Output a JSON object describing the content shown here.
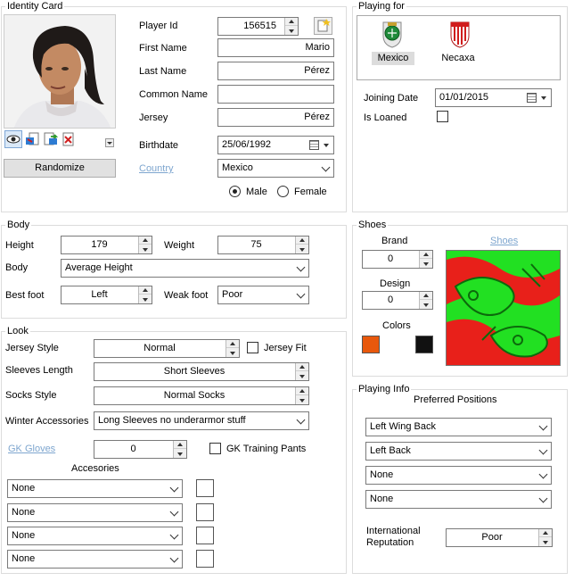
{
  "identity": {
    "title": "Identity Card",
    "player_id_label": "Player Id",
    "player_id": "156515",
    "first_name_label": "First Name",
    "first_name": "Mario",
    "last_name_label": "Last Name",
    "last_name": "Pérez",
    "common_name_label": "Common Name",
    "common_name": "",
    "jersey_label": "Jersey",
    "jersey": "Pérez",
    "birthdate_label": "Birthdate",
    "birthdate": "25/06/1992",
    "country_label": "Country",
    "country": "Mexico",
    "male_label": "Male",
    "female_label": "Female",
    "gender": "Male",
    "randomize_label": "Randomize"
  },
  "playing_for": {
    "title": "Playing for",
    "teams": [
      "Mexico",
      "Necaxa"
    ],
    "joining_date_label": "Joining Date",
    "joining_date": "01/01/2015",
    "is_loaned_label": "Is Loaned"
  },
  "body": {
    "title": "Body",
    "height_label": "Height",
    "height": "179",
    "weight_label": "Weight",
    "weight": "75",
    "body_label": "Body",
    "body_type": "Average Height",
    "best_foot_label": "Best foot",
    "best_foot": "Left",
    "weak_foot_label": "Weak foot",
    "weak_foot": "Poor"
  },
  "shoes": {
    "title": "Shoes",
    "brand_label": "Brand",
    "brand": "0",
    "design_label": "Design",
    "design": "0",
    "colors_label": "Colors",
    "shoes_link": "Shoes",
    "color1": "#e8580c",
    "color2": "#111111"
  },
  "look": {
    "title": "Look",
    "jersey_style_label": "Jersey Style",
    "jersey_style": "Normal",
    "jersey_fit_label": "Jersey Fit",
    "sleeves_label": "Sleeves Length",
    "sleeves": "Short Sleeves",
    "socks_label": "Socks Style",
    "socks": "Normal Socks",
    "winter_label": "Winter Accessories",
    "winter": "Long Sleeves no underarmor stuff",
    "gk_gloves_label": "GK Gloves",
    "gk_gloves": "0",
    "gk_pants_label": "GK Training Pants",
    "accessories_label": "Accesories",
    "accessories": [
      "None",
      "None",
      "None",
      "None"
    ]
  },
  "playing_info": {
    "title": "Playing Info",
    "preferred_label": "Preferred Positions",
    "positions": [
      "Left Wing Back",
      "Left Back",
      "None",
      "None"
    ],
    "intl_rep_label": "International Reputation",
    "intl_rep": "Poor"
  },
  "icons": [
    "eye-icon",
    "import-icon",
    "export-icon",
    "delete-icon",
    "dropdown-icon",
    "new-id-icon",
    "calendar-icon",
    "mexico-crest-icon",
    "necaxa-crest-icon"
  ]
}
